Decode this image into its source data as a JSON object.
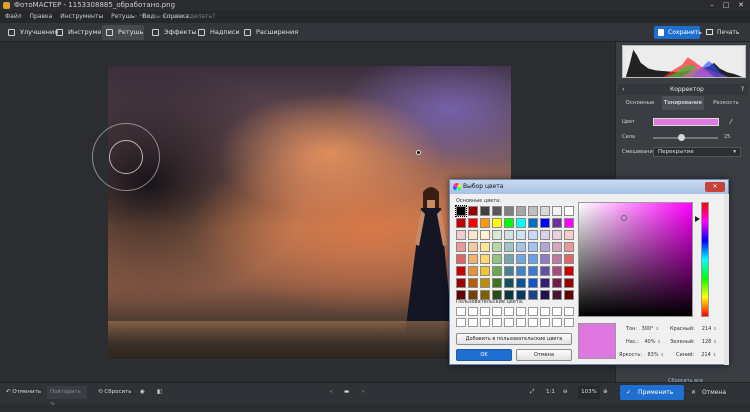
{
  "window": {
    "title": "ФотоМАСТЕР - 1153308885_обработано.png"
  },
  "menu": {
    "items": [
      "Файл",
      "Правка",
      "Инструменты",
      "Ретушь",
      "Вид",
      "Справка"
    ],
    "search_placeholder": "Что вы хотите сделать?"
  },
  "toolbar": {
    "tabs": [
      "Улучшения",
      "Инструменты",
      "Ретушь",
      "Эффекты",
      "Надписи",
      "Расширения"
    ],
    "active_tab": "Ретушь",
    "save_label": "Сохранить",
    "print_label": "Печать"
  },
  "panel": {
    "header": "Корректор",
    "help": "?",
    "tabs": [
      "Основные",
      "Тонирование",
      "Резкость"
    ],
    "active_tab": "Тонирование",
    "color_label": "Цвет",
    "color_value": "#df77e0",
    "strength_label": "Сила",
    "strength_value": "25",
    "blend_label": "Смешивание",
    "blend_value": "Перекрытие",
    "reset_all": "Сбросить все"
  },
  "bottom": {
    "undo": "Отменить",
    "redo": "Повторить",
    "reset": "Сбросить",
    "zoom_ratio": "1:1",
    "zoom_value": "103%",
    "apply": "Применить",
    "cancel": "Отмена"
  },
  "dialog": {
    "title": "Выбор цвета",
    "basic_colors_label": "Основные цвета:",
    "custom_colors_label": "Пользовательские цвета:",
    "add_custom_label": "Добавить в пользовательские цвета",
    "ok_label": "OK",
    "cancel_label": "Отмена",
    "basic_colors": [
      "#000000",
      "#990000",
      "#404040",
      "#595959",
      "#808080",
      "#a6a6a6",
      "#bfbfbf",
      "#d9d9d9",
      "#f2f2f2",
      "#ffffff",
      "#c00000",
      "#ff0000",
      "#ff9900",
      "#ffff00",
      "#00ff00",
      "#00ffff",
      "#0070c0",
      "#0000ff",
      "#7030a0",
      "#ff00ff",
      "#f4cccc",
      "#fce5cd",
      "#fff2cc",
      "#d9ead3",
      "#d0e0e3",
      "#cfe2f3",
      "#c9daf8",
      "#d9d2e9",
      "#ead1dc",
      "#f4cccc",
      "#ea9999",
      "#f9cb9c",
      "#ffe599",
      "#b6d7a8",
      "#a2c4c9",
      "#9fc5e8",
      "#a4c2f4",
      "#b4a7d6",
      "#d5a6bd",
      "#ea9999",
      "#e06666",
      "#f6b26b",
      "#ffd966",
      "#93c47d",
      "#76a5af",
      "#6fa8dc",
      "#6d9eeb",
      "#8e7cc3",
      "#c27ba0",
      "#e06666",
      "#cc0000",
      "#e69138",
      "#f1c232",
      "#6aa84f",
      "#45818e",
      "#3d85c6",
      "#3c78d8",
      "#674ea7",
      "#a64d79",
      "#cc0000",
      "#990000",
      "#b45f06",
      "#bf9000",
      "#38761d",
      "#134f5c",
      "#0b5394",
      "#1155cc",
      "#351c75",
      "#741b47",
      "#990000",
      "#660000",
      "#783f04",
      "#7f6000",
      "#274e13",
      "#0c343d",
      "#073763",
      "#1c4587",
      "#20124d",
      "#4c1130",
      "#660000"
    ],
    "hue_label": "Тон:",
    "hue_value": "300°",
    "sat_label": "Нас.:",
    "sat_value": "40%",
    "val_label": "Яркость:",
    "val_value": "83%",
    "red_label": "Красный:",
    "red_value": "214",
    "green_label": "Зеленый:",
    "green_value": "128",
    "blue_label": "Синий:",
    "blue_value": "214"
  }
}
